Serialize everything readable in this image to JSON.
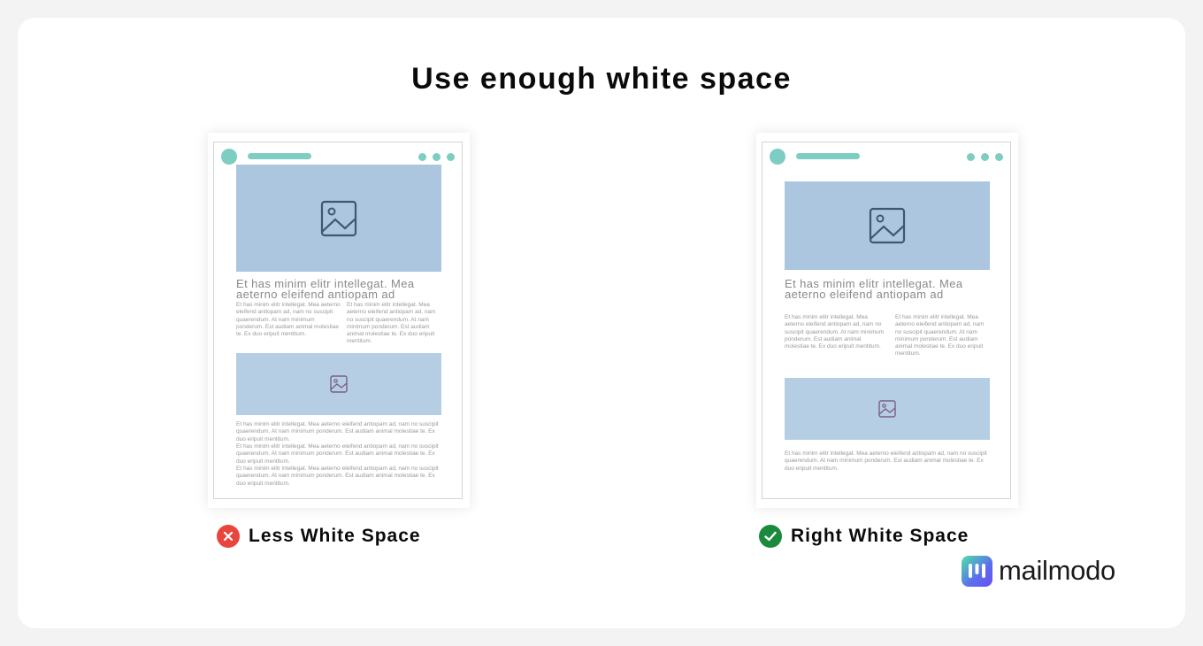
{
  "title": "Use enough white space",
  "colors": {
    "accent_teal": "#7dcdc3",
    "image_blue": "#abc6de",
    "bad_red": "#e8453c",
    "good_green": "#1b8a3c"
  },
  "left_example": {
    "label": "Less White Space",
    "status_icon": "x-circle-icon",
    "headline": "Et has minim elitr intellegat. Mea aeterno eleifend antiopam ad",
    "col1": "Et has minim elitr intellegat. Mea aeterno eleifend antiopam ad, nam no suscipit quaerendum. At nam minimum ponderum. Est audiam animal molestiae te. Ex duo eripuit mentitum.",
    "col2": "Et has minim elitr intellegat. Mea aeterno eleifend antiopam ad, nam no suscipit quaerendum. At nam minimum ponderum. Est audiam animal molestiae te. Ex duo eripuit mentitum.",
    "para1": "Et has minim elitr intellegat. Mea aeterno eleifend antiopam ad, nam no suscipit quaerendum. At nam minimum ponderum. Est audiam animal molestiae te. Ex duo eripuit mentitum.",
    "para2": "Et has minim elitr intellegat. Mea aeterno eleifend antiopam ad, nam no suscipit quaerendum. At nam minimum ponderum. Est audiam animal molestiae te. Ex duo eripuit mentitum.",
    "para3": "Et has minim elitr intellegat. Mea aeterno eleifend antiopam ad, nam no suscipit quaerendum. At nam minimum ponderum. Est audiam animal molestiae te. Ex duo eripuit mentitum."
  },
  "right_example": {
    "label": "Right White Space",
    "status_icon": "check-circle-icon",
    "headline": "Et has minim elitr intellegat. Mea aeterno eleifend antiopam ad",
    "col1": "Et has minim elitr intellegat. Mea aeterno eleifend antiopam ad, nam no suscipit quaerendum. At nam minimum ponderum. Est audiam animal molestiae te. Ex duo eripuit mentitum.",
    "col2": "Et has minim elitr intellegat. Mea aeterno eleifend antiopam ad, nam no suscipit quaerendum. At nam minimum ponderum. Est audiam animal molestiae te. Ex duo eripuit mentitum.",
    "para1": "Et has minim elitr intellegat. Mea aeterno eleifend antiopam ad, nam no suscipit quaerendum. At nam minimum ponderum. Est audiam animal molestiae te. Ex duo eripuit mentitum."
  },
  "brand": {
    "name": "mailmodo",
    "icon": "mailmodo-logo-icon"
  }
}
